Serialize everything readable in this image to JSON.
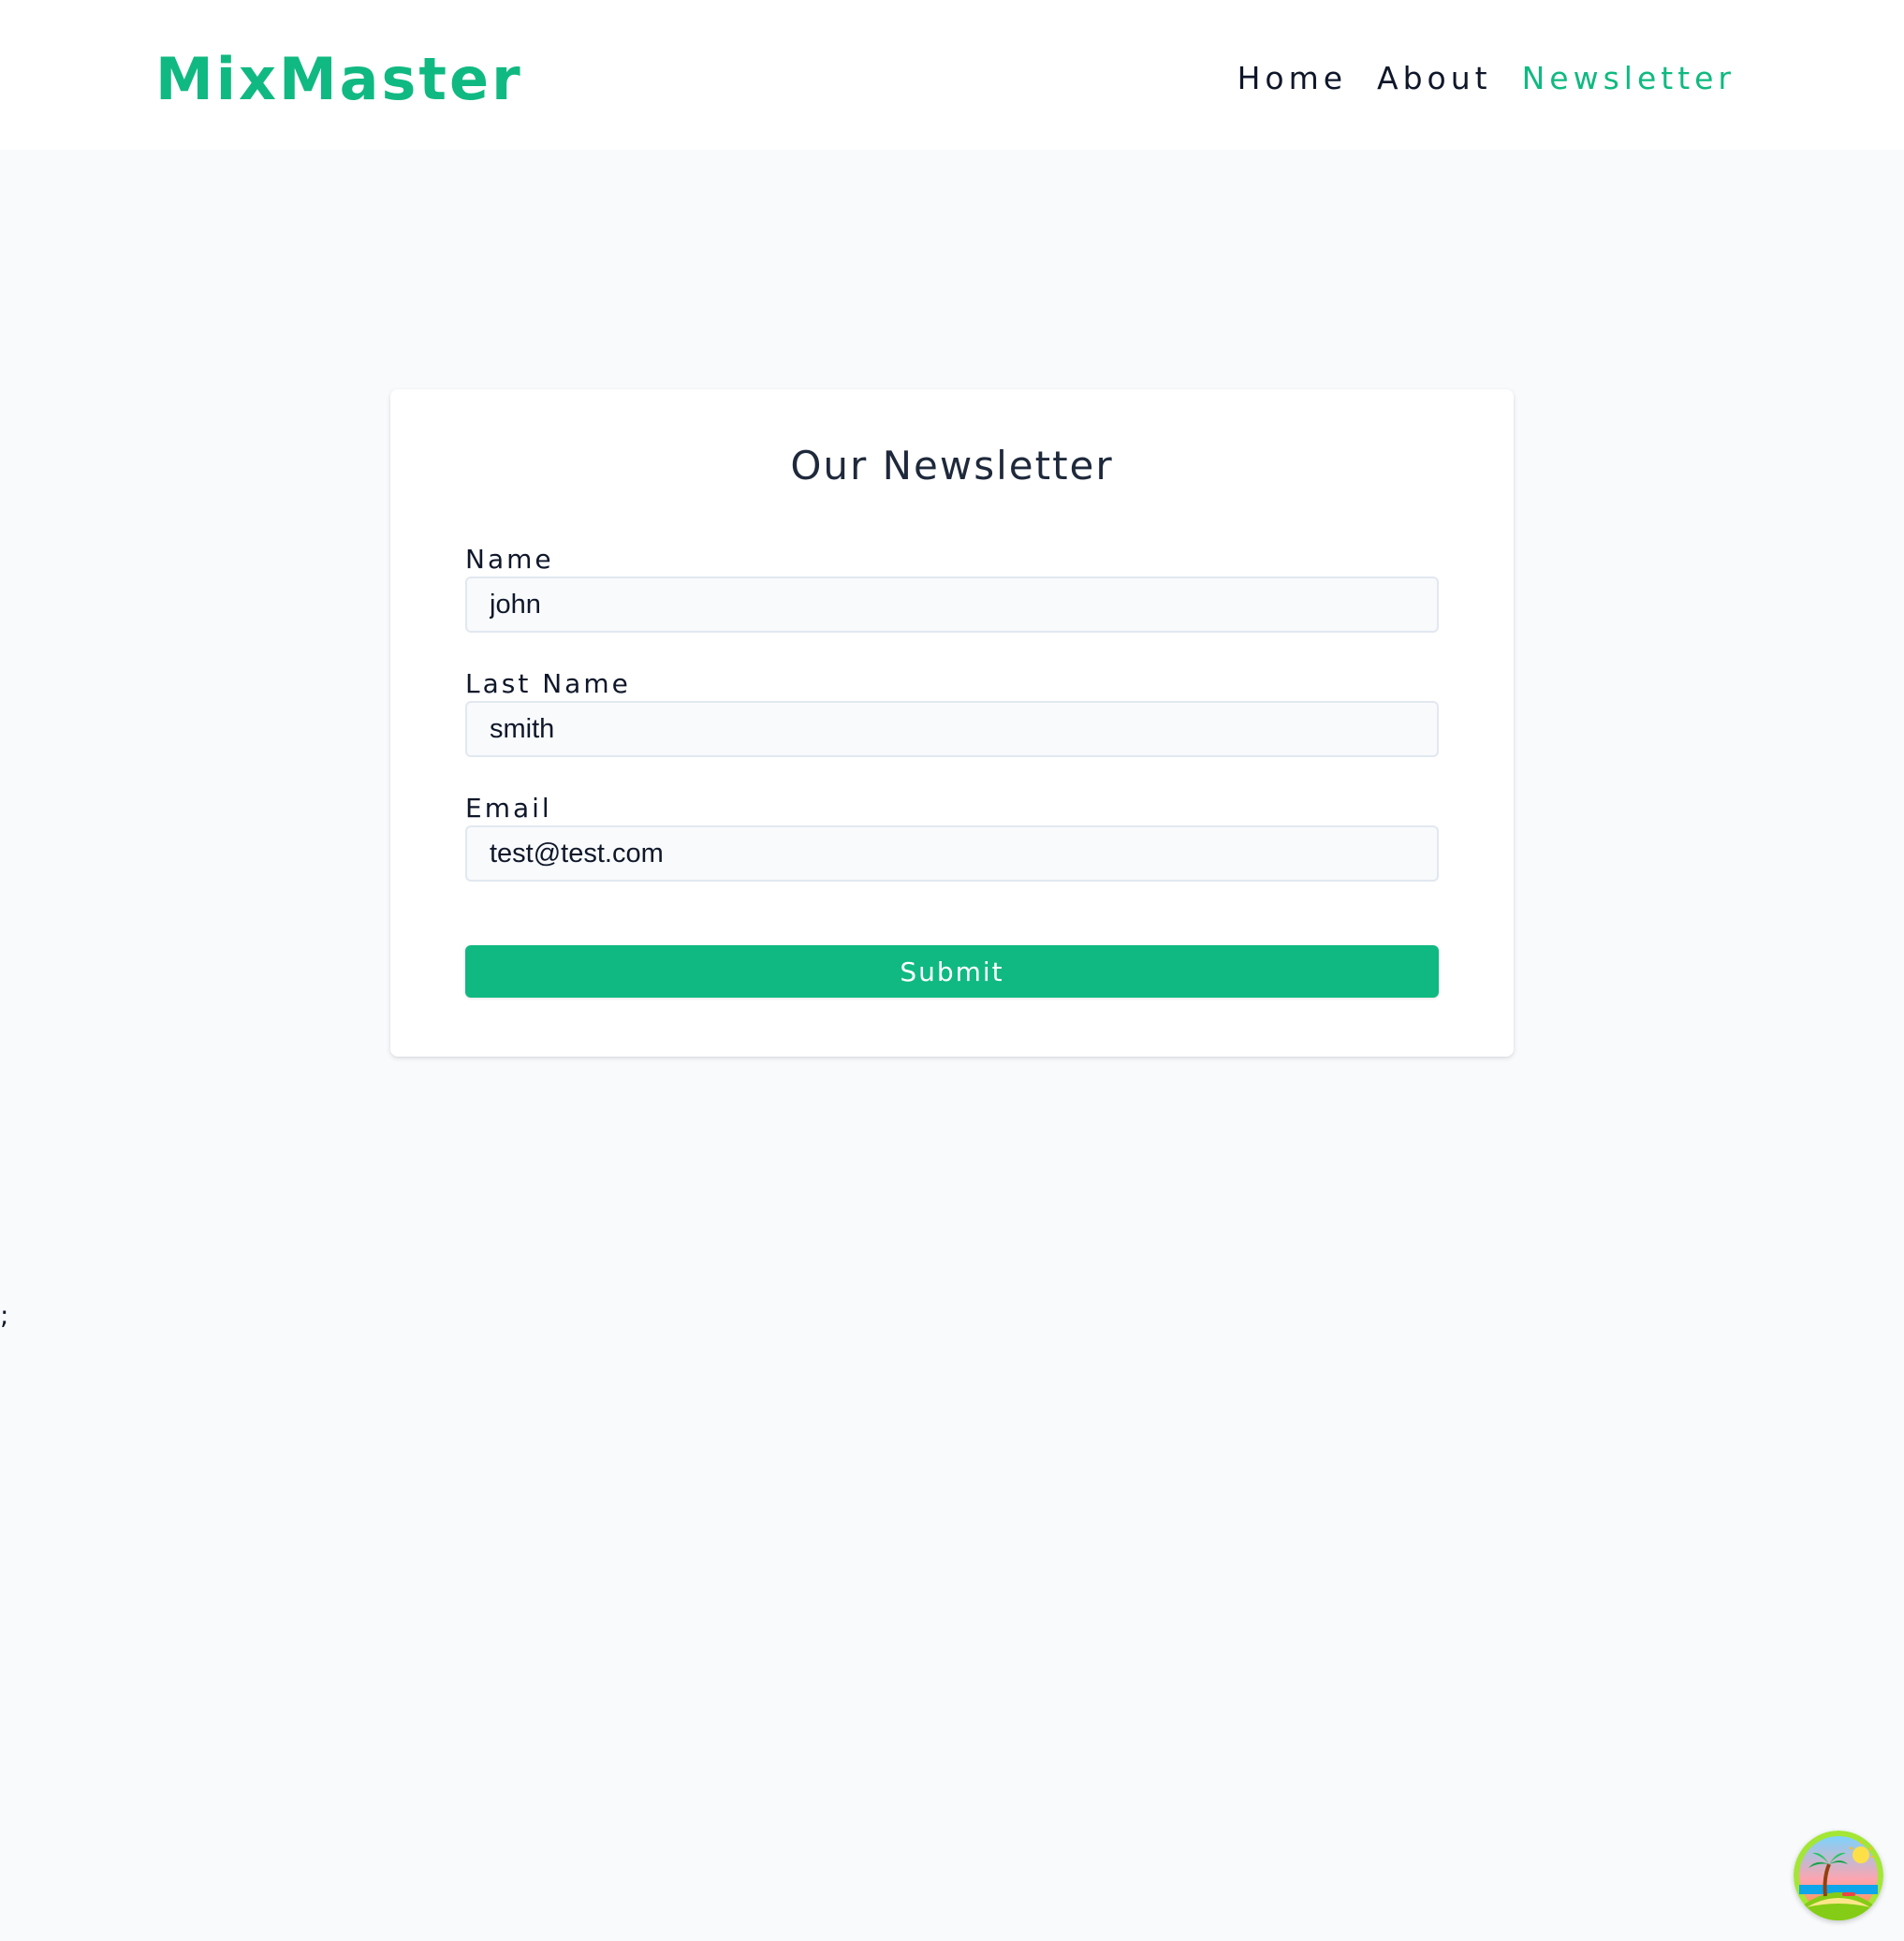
{
  "brand": {
    "name": "MixMaster",
    "color": "#10b981"
  },
  "nav": {
    "links": [
      {
        "label": "Home",
        "active": false
      },
      {
        "label": "About",
        "active": false
      },
      {
        "label": "Newsletter",
        "active": true
      }
    ]
  },
  "newsletter_form": {
    "title": "Our Newsletter",
    "fields": [
      {
        "label": "Name",
        "value": "john"
      },
      {
        "label": "Last Name",
        "value": "smith"
      },
      {
        "label": "Email",
        "value": "test@test.com"
      }
    ],
    "submit_label": "Submit"
  },
  "stray_text": ";",
  "floating_avatar": {
    "icon": "beach-island-icon"
  }
}
